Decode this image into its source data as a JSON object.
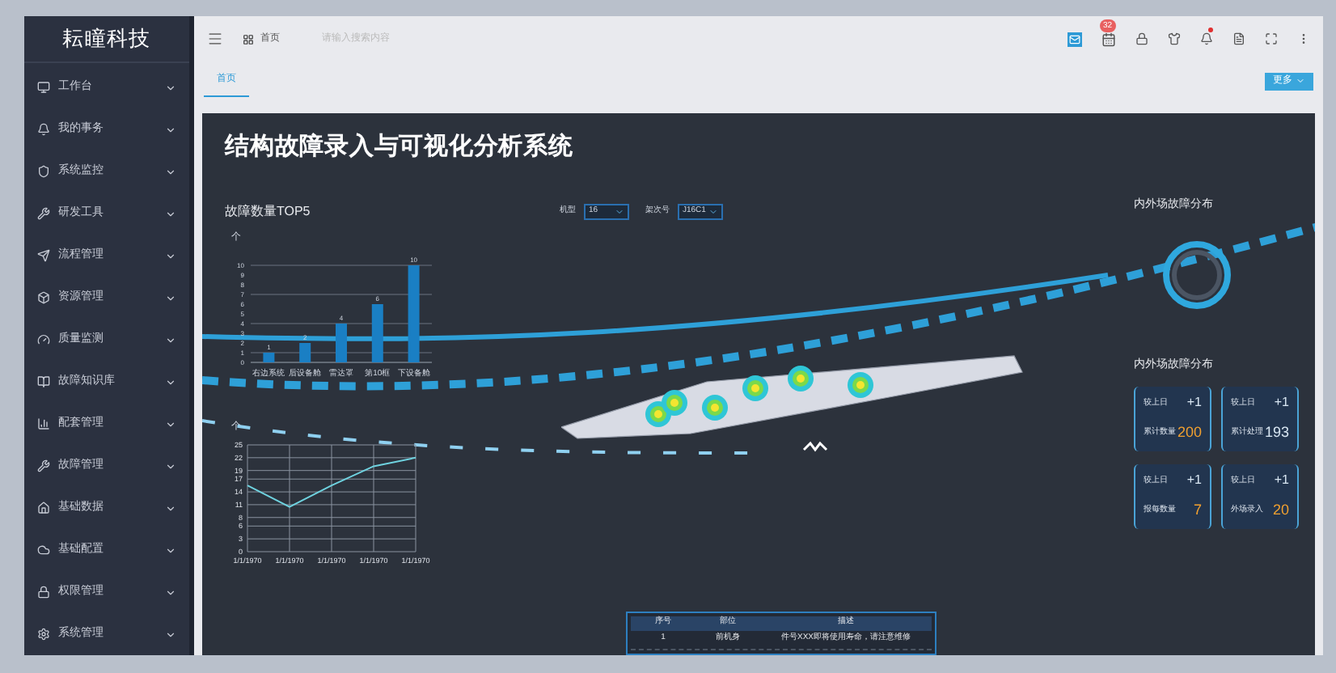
{
  "sidebar": {
    "logo": "耘瞳科技",
    "items": [
      {
        "label": "工作台",
        "expanded": false
      },
      {
        "label": "我的事务",
        "expanded": false
      },
      {
        "label": "系统监控",
        "expanded": false
      },
      {
        "label": "研发工具",
        "expanded": false
      },
      {
        "label": "流程管理",
        "expanded": false
      },
      {
        "label": "资源管理",
        "expanded": false
      },
      {
        "label": "质量监测",
        "expanded": false
      },
      {
        "label": "故障知识库",
        "expanded": false
      },
      {
        "label": "配套管理",
        "expanded": false
      },
      {
        "label": "故障管理",
        "expanded": false
      },
      {
        "label": "基础数据",
        "expanded": false
      },
      {
        "label": "基础配置",
        "expanded": false
      },
      {
        "label": "权限管理",
        "expanded": false
      },
      {
        "label": "系统管理",
        "expanded": false
      }
    ]
  },
  "topbar": {
    "breadcrumb": "首页",
    "search": {
      "placeholder": "请输入搜索内容"
    },
    "badge": "32",
    "bell_dot": true
  },
  "tabs": [
    {
      "label": "首页",
      "selected": true
    }
  ],
  "more_button": "更多",
  "dashboard": {
    "title": "结构故障录入与可视化分析系统",
    "bar_panel": {
      "title": "故障数量TOP5",
      "unit": "个",
      "chart_data": {
        "type": "bar",
        "categories": [
          "右边系统",
          "后设备舱",
          "雷达罩",
          "第10框",
          "下设备舱"
        ],
        "values": [
          1,
          2,
          4,
          6,
          10
        ],
        "yticks": [
          0,
          1,
          2,
          3,
          4,
          5,
          6,
          7,
          8,
          9,
          10
        ],
        "ylim": [
          0,
          10
        ],
        "grid": true,
        "data_labels": true
      }
    },
    "filters": [
      {
        "label": "机型",
        "value": "16"
      },
      {
        "label": "架次号",
        "value": "J16C1"
      }
    ],
    "line_panel": {
      "unit": "个",
      "chart_data": {
        "type": "line",
        "categories": [
          "1/1/1970",
          "1/1/1970",
          "1/1/1970",
          "1/1/1970",
          "1/1/1970"
        ],
        "values": [
          15.5,
          10.5,
          15.5,
          20,
          22
        ],
        "ylim": [
          0,
          25
        ],
        "grid": true,
        "yticks": [
          0,
          3,
          6,
          8,
          11,
          14,
          17,
          19,
          22,
          25
        ]
      }
    },
    "ring_title": "内外场故障分布",
    "cards_title": "内外场故障分布",
    "cards": [
      {
        "delta_label": "较上日",
        "delta": "+1",
        "label": "累计数量",
        "value": "200",
        "color": "#f0a030"
      },
      {
        "delta_label": "较上日",
        "delta": "+1",
        "label": "累计处理",
        "value": "193",
        "color": "#d8e6f2"
      },
      {
        "delta_label": "较上日",
        "delta": "+1",
        "label": "报每数量",
        "value": "7",
        "color": "#f0a030"
      },
      {
        "delta_label": "较上日",
        "delta": "+1",
        "label": "外场录入",
        "value": "20",
        "color": "#f0a030"
      }
    ],
    "table": {
      "columns": [
        "序号",
        "部位",
        "描述"
      ],
      "rows": [
        [
          "1",
          "前机身",
          "件号XXX即将使用寿命，请注意维修"
        ]
      ]
    }
  }
}
